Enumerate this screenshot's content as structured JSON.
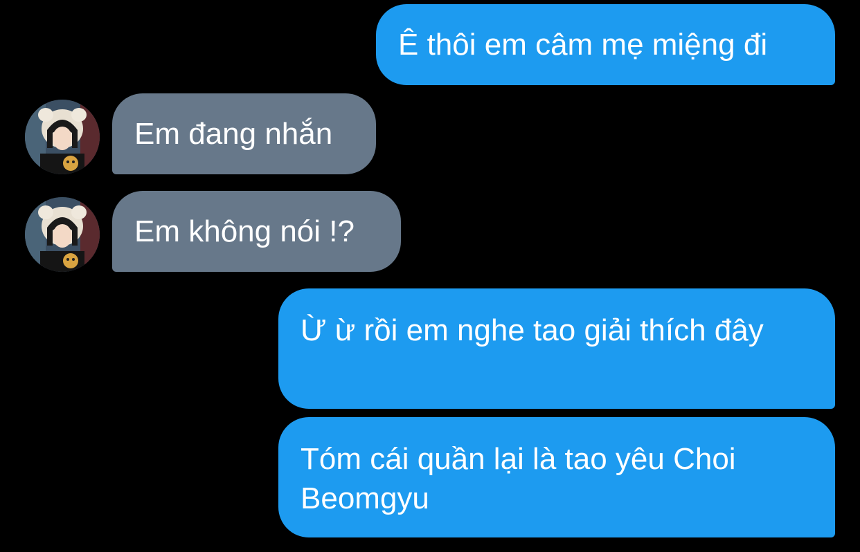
{
  "conversation": {
    "messages": [
      {
        "sender": "me",
        "text": "Ê thôi em câm mẹ miệng đi"
      },
      {
        "sender": "contact",
        "text": "Em đang nhắn",
        "avatar": "profile-photo"
      },
      {
        "sender": "contact",
        "text": "Em không nói !?",
        "avatar": "profile-photo"
      },
      {
        "sender": "me",
        "text": "Ừ ừ rồi em nghe tao giải thích đây"
      },
      {
        "sender": "me",
        "text": "Tóm cái quần lại là tao yêu Choi Beomgyu"
      }
    ]
  },
  "colors": {
    "background": "#000000",
    "sent_bubble": "#1d9bf0",
    "received_bubble": "#67788a",
    "text": "#ffffff"
  }
}
